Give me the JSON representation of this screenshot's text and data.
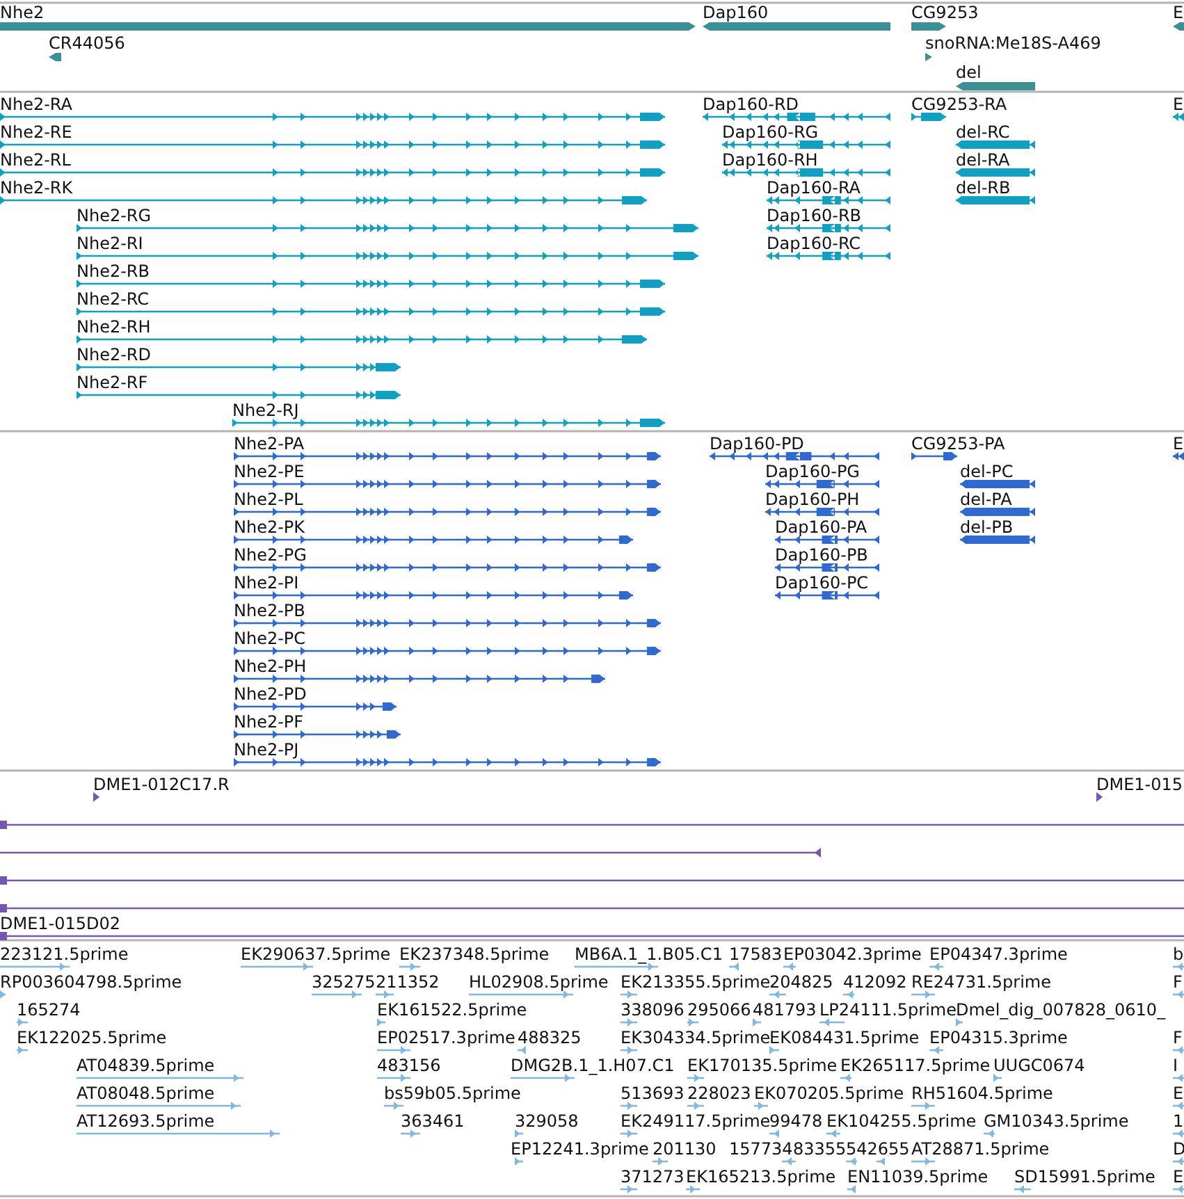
{
  "tracks": [
    {
      "kind": "gene",
      "features": [
        {
          "label": "Nhe2",
          "reverse": false
        },
        {
          "label": "Dap160",
          "reverse": true
        },
        {
          "label": "CG9253",
          "reverse": false
        },
        {
          "label": "E",
          "reverse": true
        },
        {
          "label": "CR44056",
          "reverse": true
        },
        {
          "label": "snoRNA:Me18S-A469",
          "reverse": false
        },
        {
          "label": "del",
          "reverse": true
        }
      ]
    },
    {
      "kind": "transcript",
      "features": [
        {
          "label": "Nhe2-RA",
          "reverse": false
        },
        {
          "label": "Dap160-RD",
          "reverse": true
        },
        {
          "label": "CG9253-RA",
          "reverse": false
        },
        {
          "label": "E",
          "reverse": true
        },
        {
          "label": "Nhe2-RE",
          "reverse": false
        },
        {
          "label": "Dap160-RG",
          "reverse": true
        },
        {
          "label": "del-RC",
          "reverse": true
        },
        {
          "label": "Nhe2-RL",
          "reverse": false
        },
        {
          "label": "Dap160-RH",
          "reverse": true
        },
        {
          "label": "del-RA",
          "reverse": true
        },
        {
          "label": "Nhe2-RK",
          "reverse": false
        },
        {
          "label": "Dap160-RA",
          "reverse": true
        },
        {
          "label": "del-RB",
          "reverse": true
        },
        {
          "label": "Nhe2-RG",
          "reverse": false
        },
        {
          "label": "Dap160-RB",
          "reverse": true
        },
        {
          "label": "Nhe2-RI",
          "reverse": false
        },
        {
          "label": "Dap160-RC",
          "reverse": true
        },
        {
          "label": "Nhe2-RB",
          "reverse": false
        },
        {
          "label": "Nhe2-RC",
          "reverse": false
        },
        {
          "label": "Nhe2-RH",
          "reverse": false
        },
        {
          "label": "Nhe2-RD",
          "reverse": false
        },
        {
          "label": "Nhe2-RF",
          "reverse": false
        },
        {
          "label": "Nhe2-RJ",
          "reverse": false
        }
      ]
    },
    {
      "kind": "protein",
      "features": [
        {
          "label": "Nhe2-PA",
          "reverse": false
        },
        {
          "label": "Dap160-PD",
          "reverse": true
        },
        {
          "label": "CG9253-PA",
          "reverse": false
        },
        {
          "label": "E",
          "reverse": true
        },
        {
          "label": "Nhe2-PE",
          "reverse": false
        },
        {
          "label": "Dap160-PG",
          "reverse": true
        },
        {
          "label": "del-PC",
          "reverse": true
        },
        {
          "label": "Nhe2-PL",
          "reverse": false
        },
        {
          "label": "Dap160-PH",
          "reverse": true
        },
        {
          "label": "del-PA",
          "reverse": true
        },
        {
          "label": "Nhe2-PK",
          "reverse": false
        },
        {
          "label": "Dap160-PA",
          "reverse": true
        },
        {
          "label": "del-PB",
          "reverse": true
        },
        {
          "label": "Nhe2-PG",
          "reverse": false
        },
        {
          "label": "Dap160-PB",
          "reverse": true
        },
        {
          "label": "Nhe2-PI",
          "reverse": false
        },
        {
          "label": "Dap160-PC",
          "reverse": true
        },
        {
          "label": "Nhe2-PB",
          "reverse": false
        },
        {
          "label": "Nhe2-PC",
          "reverse": false
        },
        {
          "label": "Nhe2-PH",
          "reverse": false
        },
        {
          "label": "Nhe2-PD",
          "reverse": false
        },
        {
          "label": "Nhe2-PF",
          "reverse": false
        },
        {
          "label": "Nhe2-PJ",
          "reverse": false
        }
      ]
    },
    {
      "kind": "clone",
      "features": [
        {
          "label": "DME1-012C17.R",
          "reverse": false
        },
        {
          "label": "DME1-015",
          "reverse": false
        },
        {
          "reverse": false
        },
        {
          "reverse": true
        },
        {
          "reverse": false
        },
        {
          "reverse": false
        },
        {
          "label": "DME1-015D02",
          "reverse": false
        }
      ]
    },
    {
      "kind": "est",
      "features": [
        {
          "label": "223121.5prime",
          "reverse": false
        },
        {
          "label": "EK290637.5prime",
          "reverse": false
        },
        {
          "label": "EK237348.5prime",
          "reverse": false
        },
        {
          "label": "MB6A.1_1.B05.C1",
          "reverse": false
        },
        {
          "label": "17583",
          "reverse": true
        },
        {
          "label": "EP03042.3prime",
          "reverse": true
        },
        {
          "label": "EP04347.3prime",
          "reverse": true
        },
        {
          "label": "b",
          "reverse": true
        },
        {
          "label": "RP003604798.5prime",
          "reverse": false
        },
        {
          "label": "325275",
          "reverse": false
        },
        {
          "label": "211352",
          "reverse": false
        },
        {
          "label": "HL02908.5prime",
          "reverse": false
        },
        {
          "label": "EK213355.5prime",
          "reverse": false
        },
        {
          "label": "204825",
          "reverse": true
        },
        {
          "label": "412092",
          "reverse": true
        },
        {
          "label": "RE24731.5prime",
          "reverse": false
        },
        {
          "label": "F",
          "reverse": true
        },
        {
          "label": "165274",
          "reverse": false
        },
        {
          "label": "EK161522.5prime",
          "reverse": false
        },
        {
          "label": "338096",
          "reverse": false
        },
        {
          "label": "295066",
          "reverse": false
        },
        {
          "label": "481793",
          "reverse": false
        },
        {
          "label": "LP24111.5prime",
          "reverse": true
        },
        {
          "label": "Dmel_dig_007828_0610_",
          "reverse": false
        },
        {
          "label": "EK122025.5prime",
          "reverse": false
        },
        {
          "label": "EP02517.3prime",
          "reverse": false
        },
        {
          "label": "488325",
          "reverse": true
        },
        {
          "label": "EK304334.5prime",
          "reverse": false
        },
        {
          "label": "EK084431.5prime",
          "reverse": false
        },
        {
          "label": "EP04315.3prime",
          "reverse": true
        },
        {
          "label": "F",
          "reverse": true
        },
        {
          "label": "AT04839.5prime",
          "reverse": false
        },
        {
          "label": "483156",
          "reverse": false
        },
        {
          "label": "DMG2B.1_1.H07.C1",
          "reverse": false
        },
        {
          "label": "EK170135.5prime",
          "reverse": false
        },
        {
          "label": "EK265117.5prime",
          "reverse": true
        },
        {
          "label": "UUGC0674",
          "reverse": false
        },
        {
          "label": "I",
          "reverse": true
        },
        {
          "label": "AT08048.5prime",
          "reverse": false
        },
        {
          "label": "bs59b05.5prime",
          "reverse": false
        },
        {
          "label": "513693",
          "reverse": false
        },
        {
          "label": "228023",
          "reverse": false
        },
        {
          "label": "EK070205.5prime",
          "reverse": false
        },
        {
          "label": "RH51604.5prime",
          "reverse": false
        },
        {
          "label": "E",
          "reverse": true
        },
        {
          "label": "AT12693.5prime",
          "reverse": false
        },
        {
          "label": "363461",
          "reverse": false
        },
        {
          "label": "329058",
          "reverse": false
        },
        {
          "label": "EK249117.5prime",
          "reverse": false
        },
        {
          "label": "99478",
          "reverse": true
        },
        {
          "label": "EK104255.5prime",
          "reverse": true
        },
        {
          "label": "GM10343.5prime",
          "reverse": true
        },
        {
          "label": "1",
          "reverse": true
        },
        {
          "label": "EP12241.3prime",
          "reverse": false
        },
        {
          "label": "201130",
          "reverse": false
        },
        {
          "label": "157734",
          "reverse": true
        },
        {
          "label": "83355",
          "reverse": true
        },
        {
          "label": "542655",
          "reverse": true
        },
        {
          "label": "AT28871.5prime",
          "reverse": false
        },
        {
          "label": "D",
          "reverse": true
        },
        {
          "label": "371273",
          "reverse": false
        },
        {
          "label": "EK165213.5prime",
          "reverse": false
        },
        {
          "label": "EN11039.5prime",
          "reverse": true
        },
        {
          "label": "SD15991.5prime",
          "reverse": true
        },
        {
          "label": "E",
          "reverse": true
        }
      ]
    }
  ]
}
